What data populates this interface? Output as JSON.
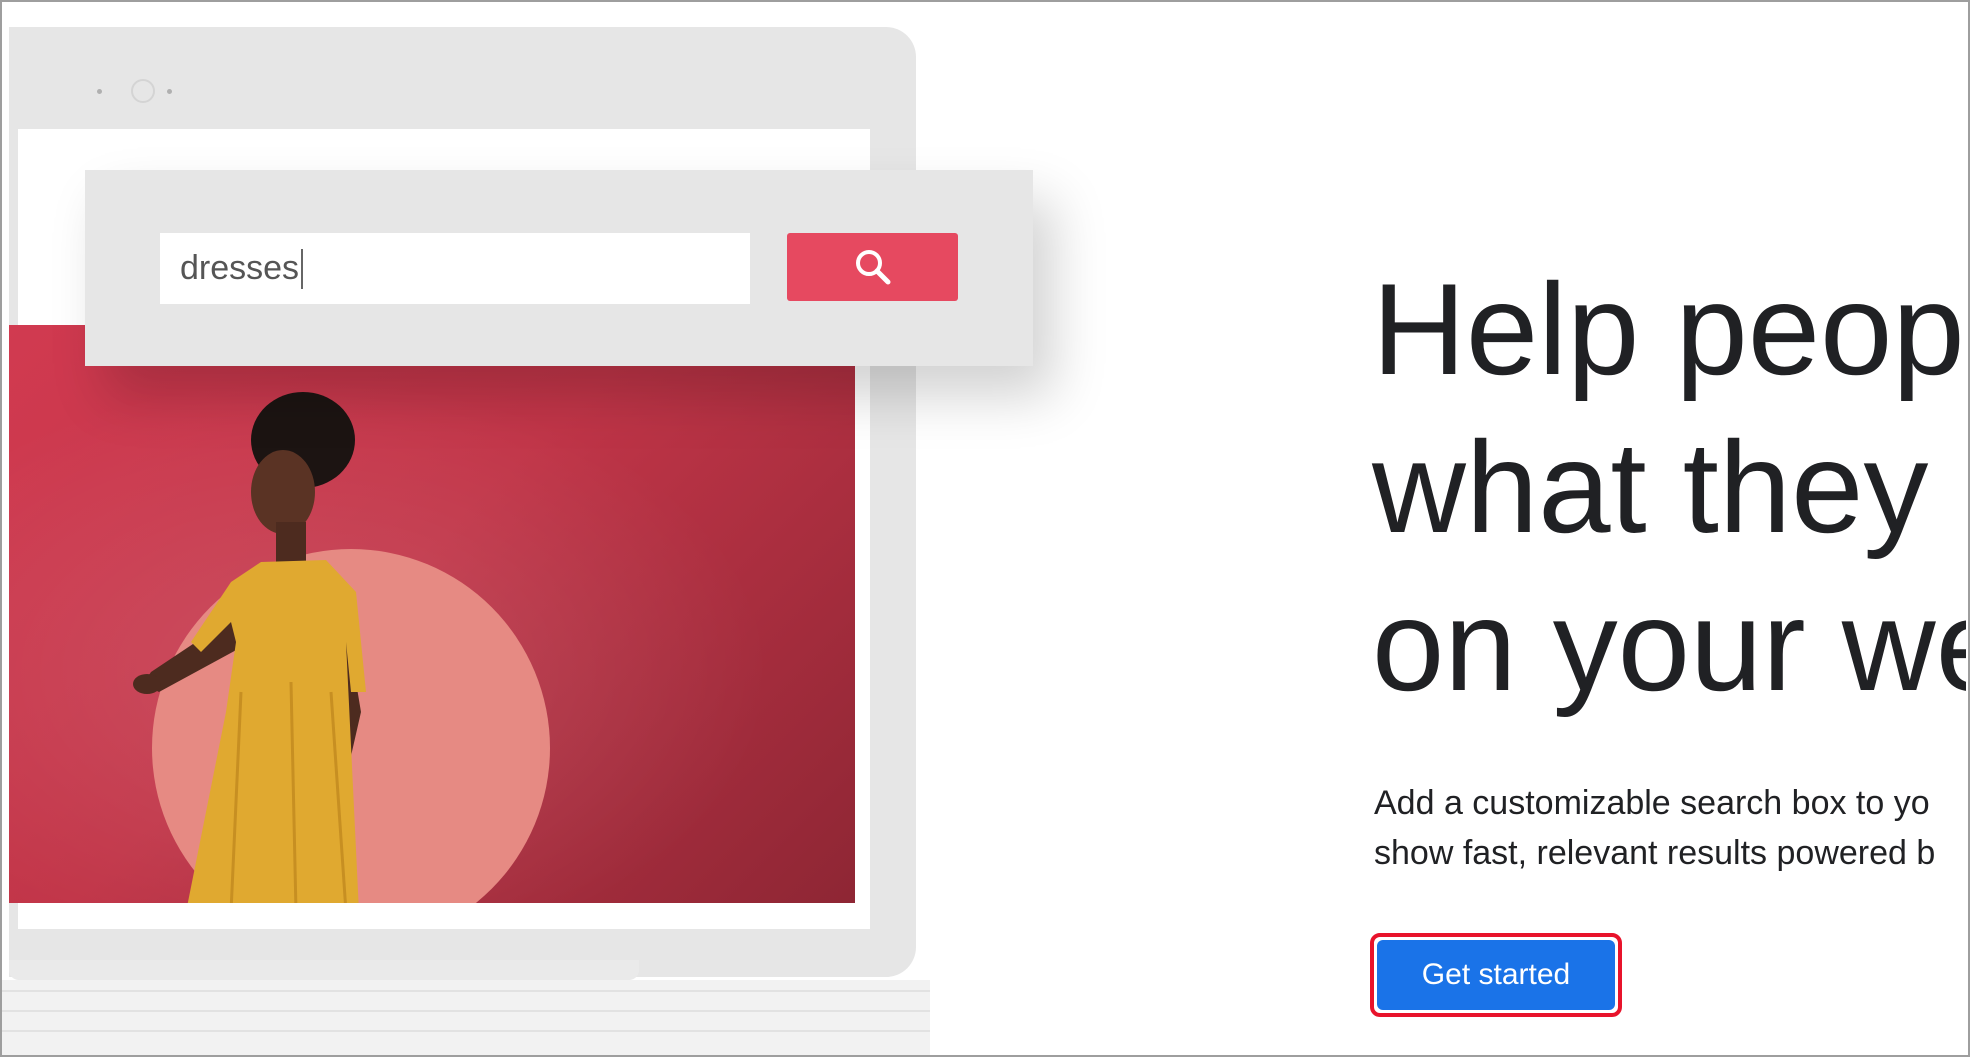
{
  "search": {
    "query": "dresses",
    "button_icon": "search-icon"
  },
  "hero": {
    "headline_lines": [
      "Help peop",
      "what they",
      "on your we"
    ],
    "description_lines": [
      "Add a customizable search box to yo",
      "show fast, relevant results powered b"
    ]
  },
  "cta": {
    "label": "Get started",
    "highlight_color": "#e8132b"
  },
  "colors": {
    "accent_pink": "#e64960",
    "primary_blue": "#1a73e8",
    "dress_yellow": "#e0a930"
  }
}
